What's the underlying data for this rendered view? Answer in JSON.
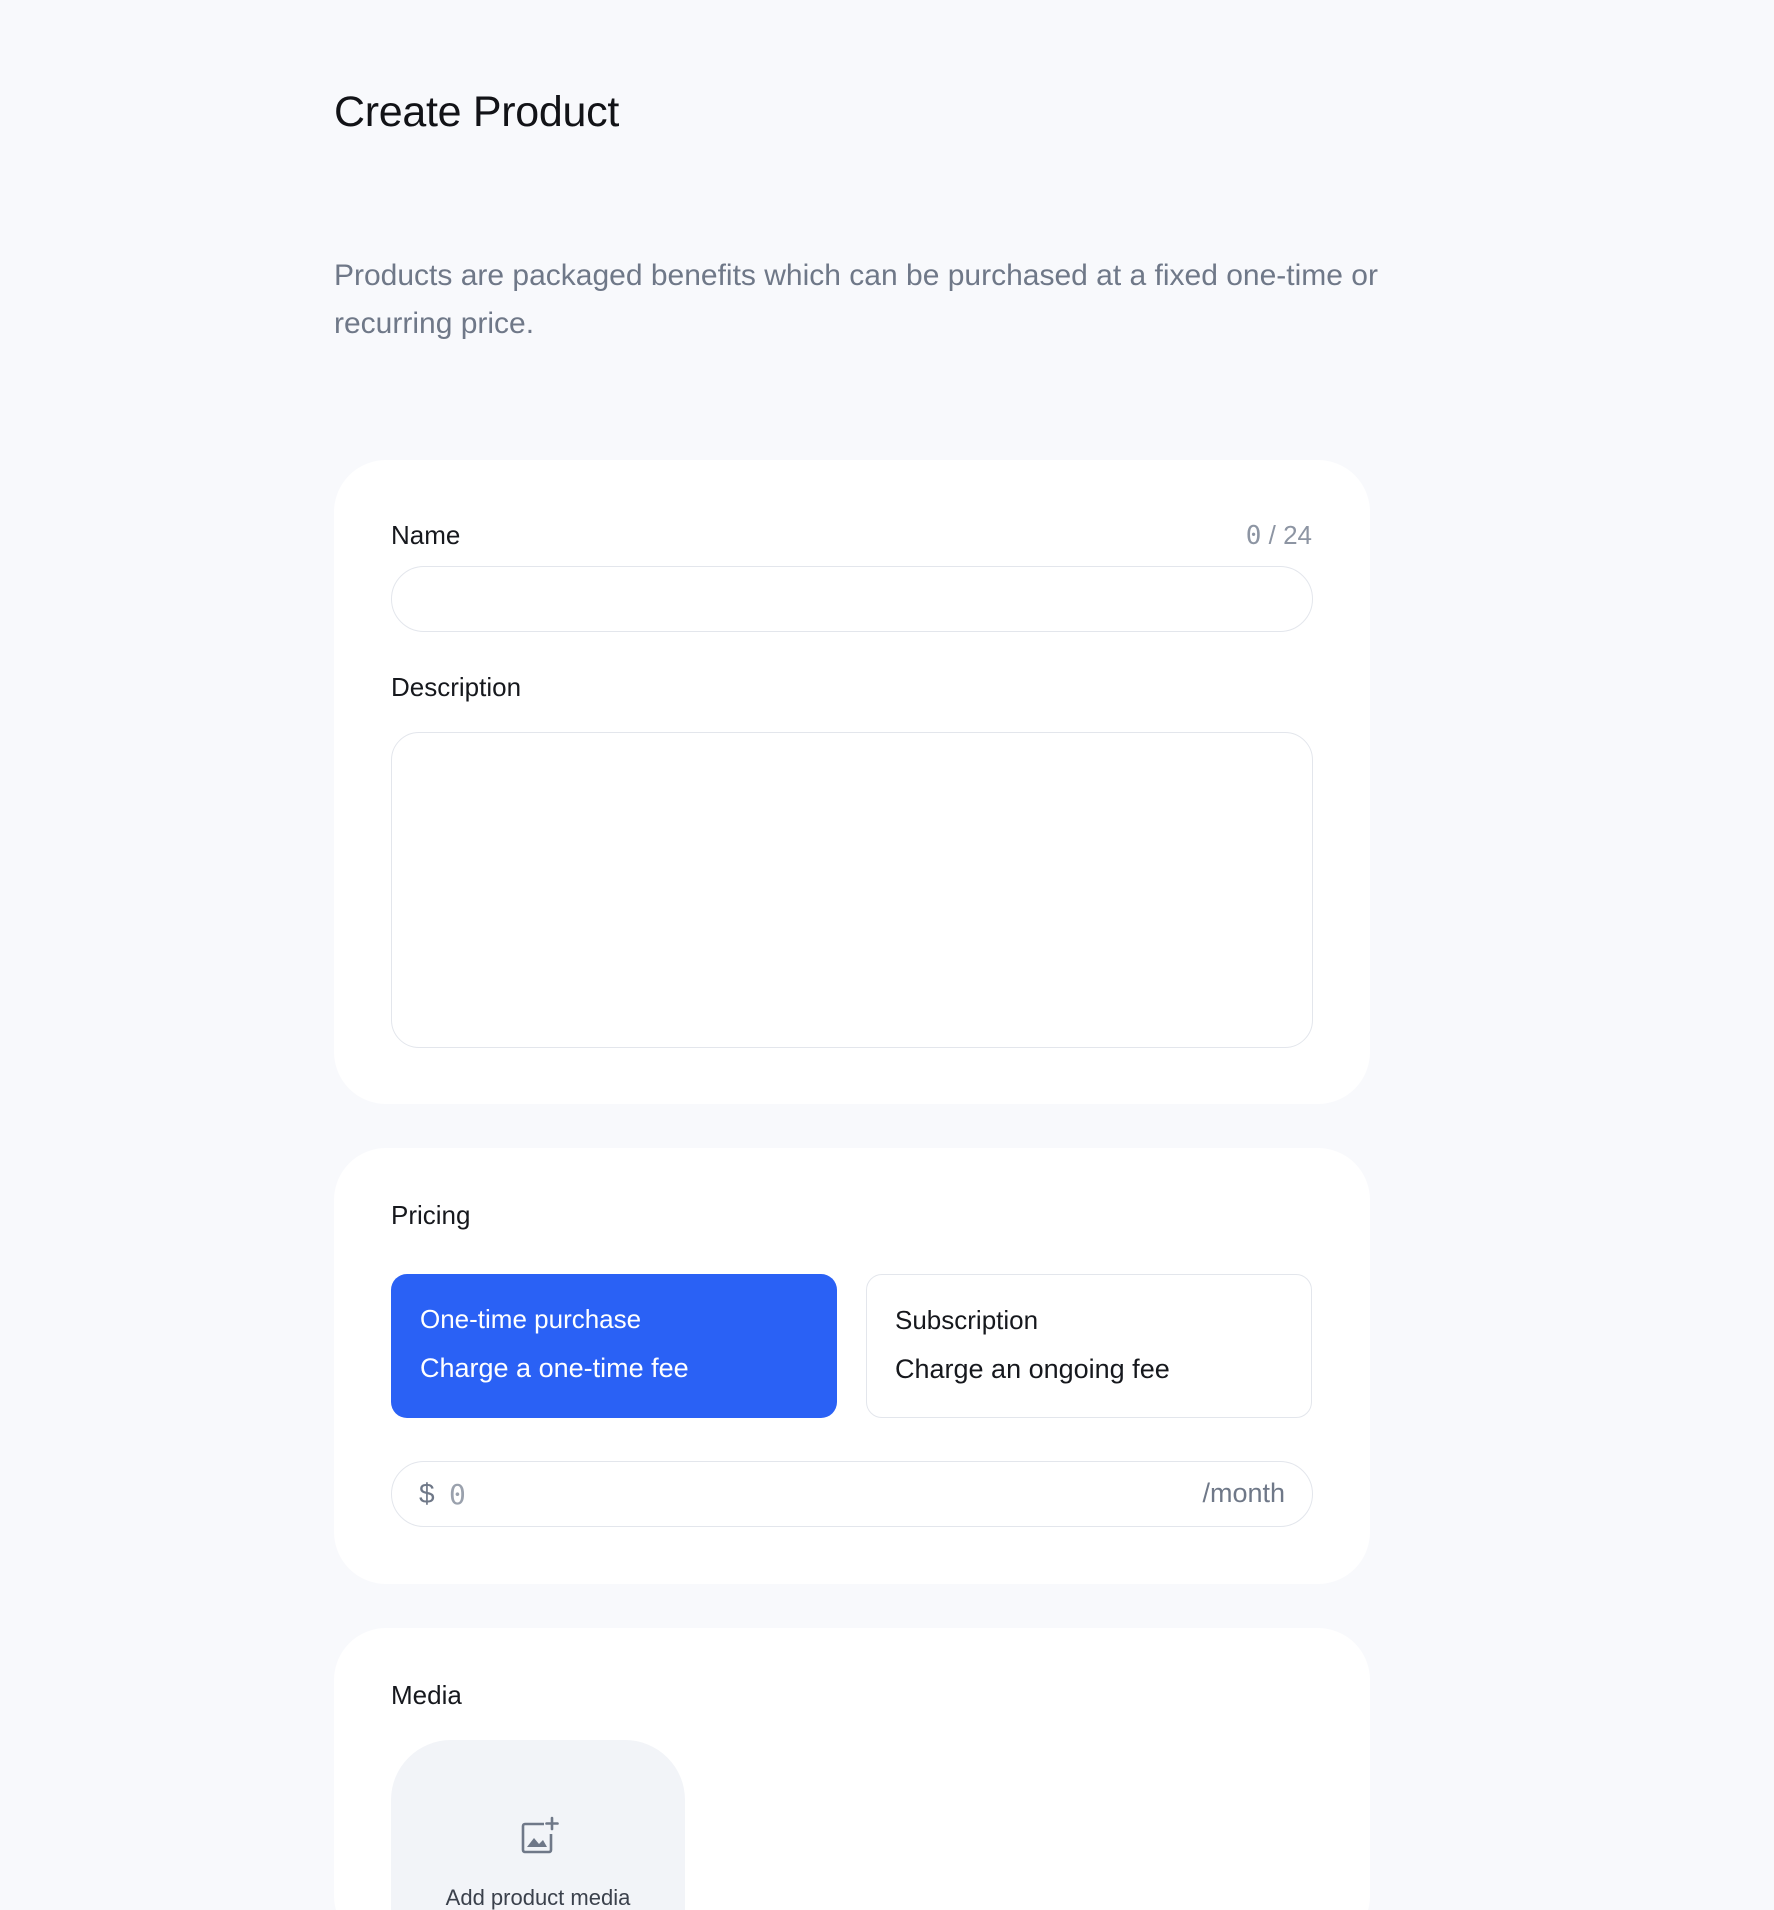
{
  "page": {
    "title": "Create Product",
    "description": "Products are packaged benefits which can be purchased at a fixed one-time or recurring price."
  },
  "details": {
    "name_label": "Name",
    "name_value": "",
    "name_count_current": "0",
    "name_count_rest": " / 24",
    "description_label": "Description",
    "description_value": ""
  },
  "pricing": {
    "label": "Pricing",
    "options": [
      {
        "title": "One-time purchase",
        "subtitle": "Charge a one-time fee",
        "selected": true
      },
      {
        "title": "Subscription",
        "subtitle": "Charge an ongoing fee",
        "selected": false
      }
    ],
    "currency_symbol": "$",
    "amount_placeholder": "0",
    "interval": "/month"
  },
  "media": {
    "label": "Media",
    "add_label": "Add product media",
    "icon": "image-plus-icon"
  },
  "colors": {
    "accent": "#2a61f5",
    "background": "#f8f9fc",
    "muted_text": "#6f7888"
  }
}
